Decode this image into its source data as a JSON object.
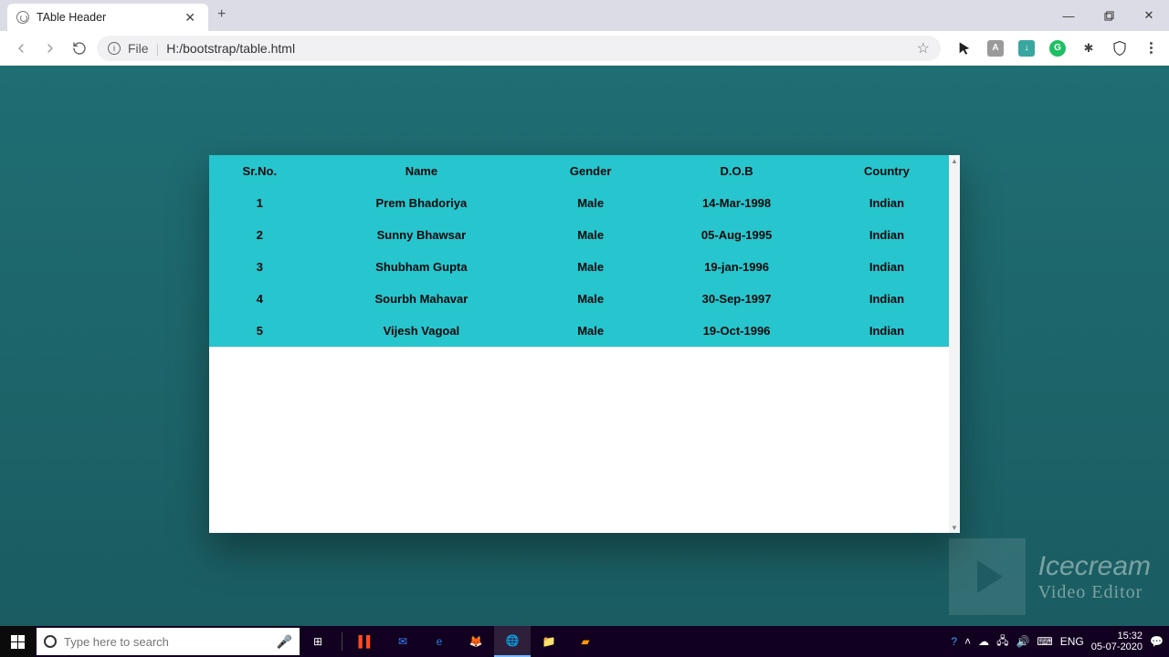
{
  "browser": {
    "tab_title": "TAble Header",
    "new_tab_glyph": "+",
    "close_glyph": "✕",
    "file_label": "File",
    "url": "H:/bootstrap/table.html"
  },
  "window_controls": {
    "min": "—",
    "max": "❐",
    "close": "✕"
  },
  "toolbar_ext": {
    "adobe": "A",
    "idm": "↓",
    "abp": "A",
    "grammarly": "G",
    "puzzle": "✦",
    "brave": "🛡"
  },
  "table": {
    "headers": [
      "Sr.No.",
      "Name",
      "Gender",
      "D.O.B",
      "Country"
    ],
    "rows": [
      {
        "sr": "1",
        "name": "Prem Bhadoriya",
        "gender": "Male",
        "dob": "14-Mar-1998",
        "country": "Indian"
      },
      {
        "sr": "2",
        "name": "Sunny Bhawsar",
        "gender": "Male",
        "dob": "05-Aug-1995",
        "country": "Indian"
      },
      {
        "sr": "3",
        "name": "Shubham Gupta",
        "gender": "Male",
        "dob": "19-jan-1996",
        "country": "Indian"
      },
      {
        "sr": "4",
        "name": "Sourbh Mahavar",
        "gender": "Male",
        "dob": "30-Sep-1997",
        "country": "Indian"
      },
      {
        "sr": "5",
        "name": "Vijesh Vagoal",
        "gender": "Male",
        "dob": "19-Oct-1996",
        "country": "Indian"
      }
    ]
  },
  "watermark": {
    "line1": "Icecream",
    "line2": "Video Editor"
  },
  "taskbar": {
    "search_placeholder": "Type here to search",
    "lang": "ENG",
    "time": "15:32",
    "date": "05-07-2020"
  }
}
